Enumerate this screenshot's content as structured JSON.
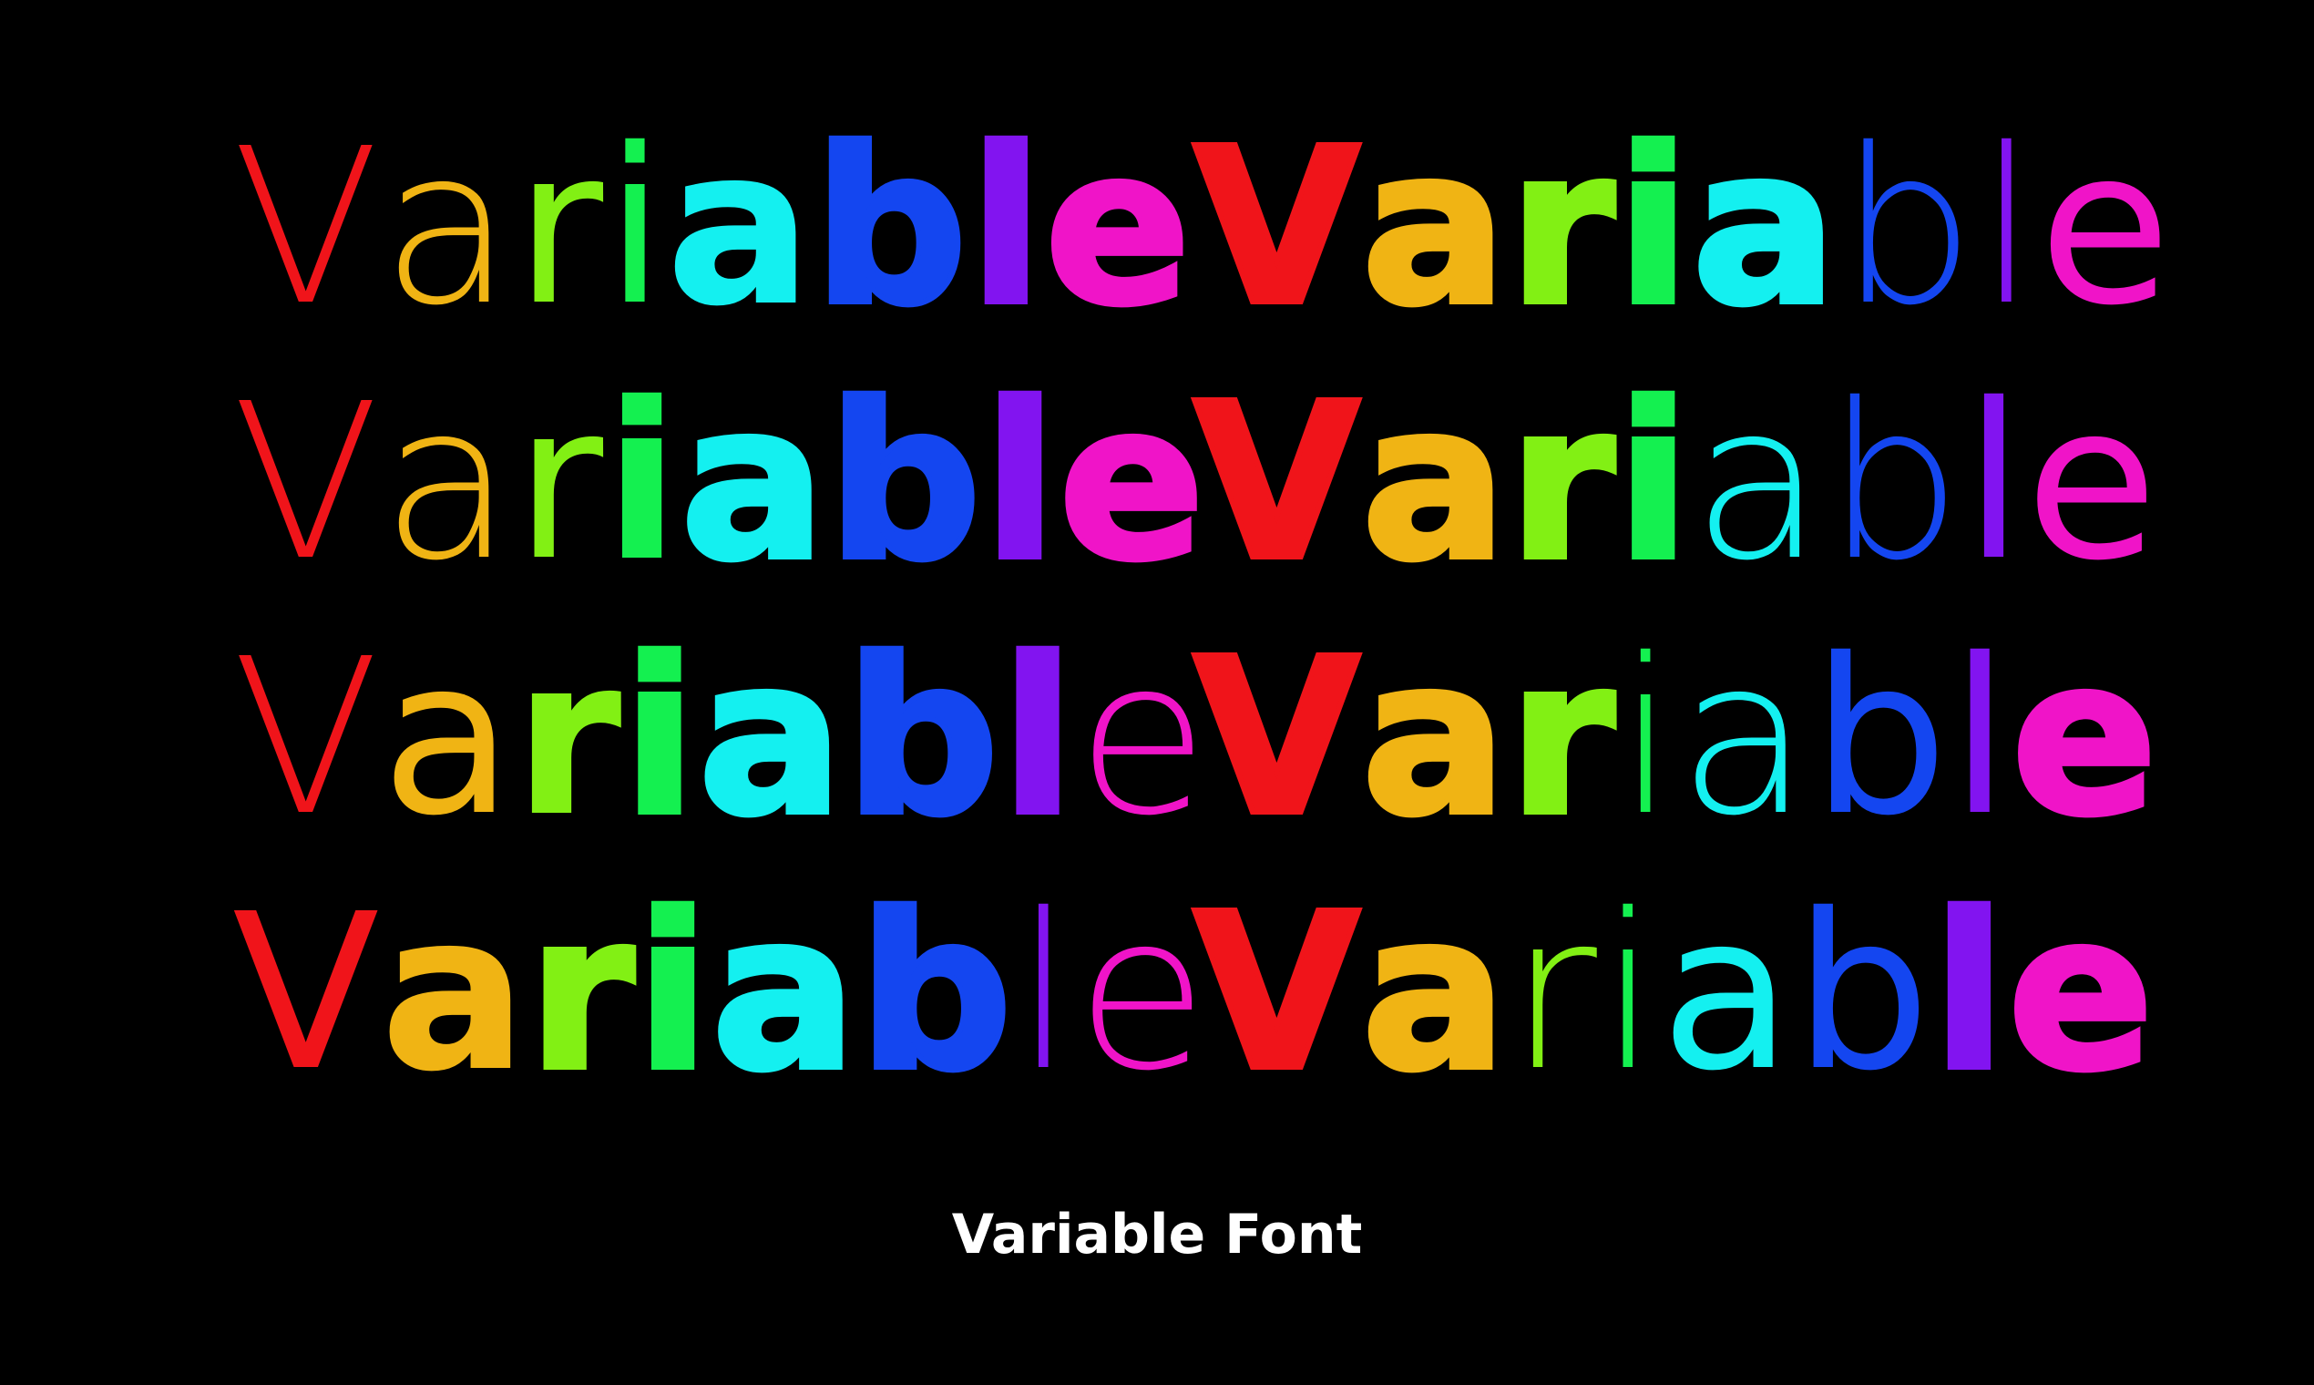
{
  "caption": "Variable Font",
  "palette": [
    "#f0141a",
    "#f0b414",
    "#82f014",
    "#14f050",
    "#14f0f0",
    "#1446f0",
    "#8214f0",
    "#f014c8"
  ],
  "rows": [
    {
      "words": [
        {
          "text": "Variable",
          "weights": [
            100,
            200,
            300,
            500,
            700,
            800,
            900,
            900
          ]
        },
        {
          "text": "Variable",
          "weights": [
            900,
            900,
            900,
            900,
            900,
            100,
            200,
            300
          ]
        }
      ]
    },
    {
      "words": [
        {
          "text": "Variable",
          "weights": [
            100,
            200,
            400,
            600,
            800,
            900,
            900,
            900
          ]
        },
        {
          "text": "Variable",
          "weights": [
            900,
            900,
            900,
            900,
            100,
            200,
            300,
            400
          ]
        }
      ]
    },
    {
      "words": [
        {
          "text": "Variable",
          "weights": [
            200,
            300,
            600,
            800,
            900,
            900,
            800,
            100
          ]
        },
        {
          "text": "Variable",
          "weights": [
            900,
            900,
            900,
            100,
            200,
            300,
            400,
            900
          ]
        }
      ]
    },
    {
      "words": [
        {
          "text": "Variable",
          "weights": [
            500,
            700,
            800,
            900,
            900,
            900,
            100,
            200
          ]
        },
        {
          "text": "Variable",
          "weights": [
            900,
            900,
            100,
            200,
            300,
            400,
            800,
            900
          ]
        }
      ]
    }
  ]
}
